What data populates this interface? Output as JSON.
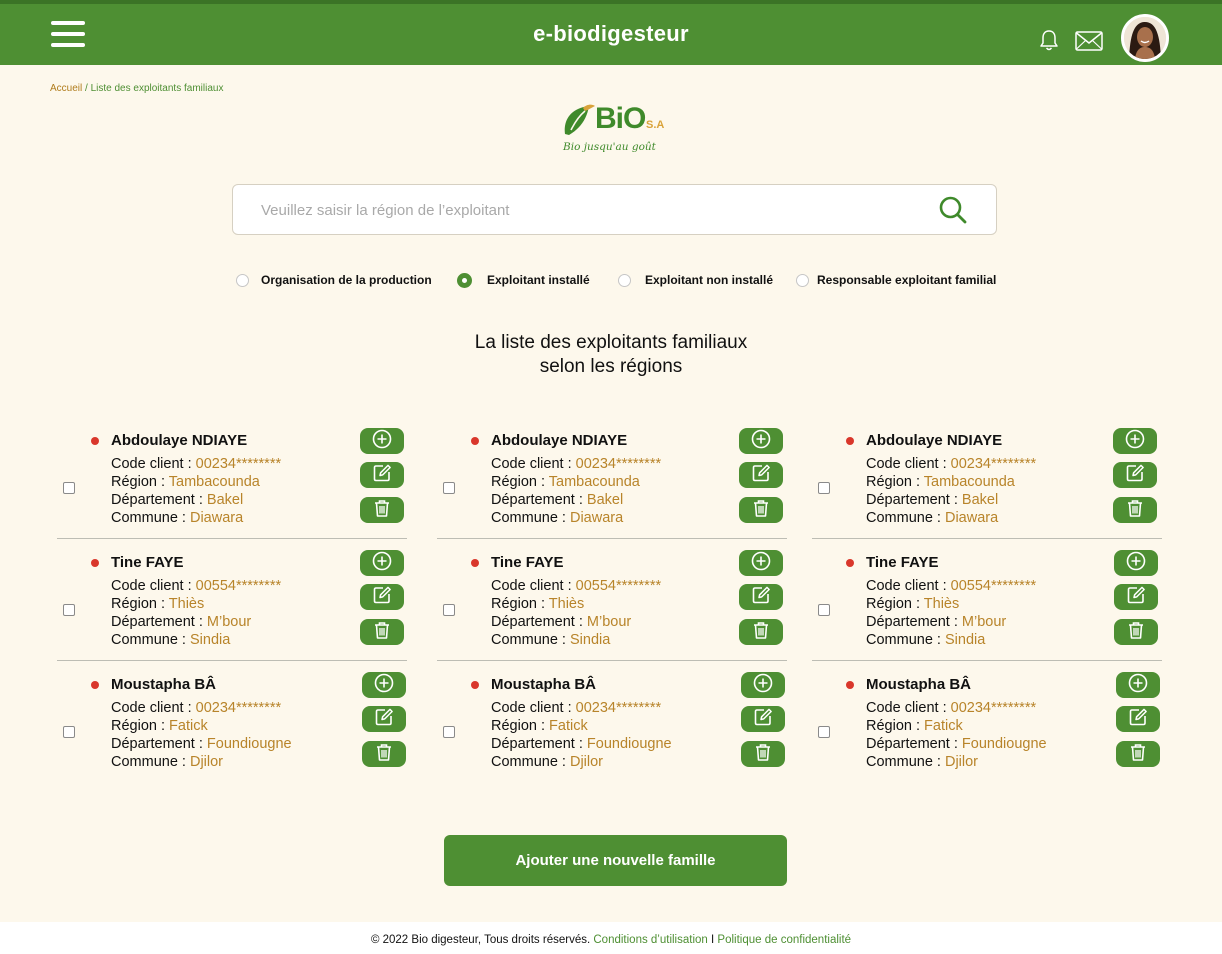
{
  "header": {
    "brand": "e-biodigesteur",
    "menu_icon": "hamburger-menu-icon",
    "bell_icon": "bell-icon",
    "mail_icon": "envelope-icon",
    "accent_color": "#4e8f33"
  },
  "breadcrumb": {
    "home": "Accueil",
    "separator": " / ",
    "current": "Liste des exploitants familiaux"
  },
  "logo": {
    "word": "BiO",
    "suffix": "S.A",
    "tagline": "Bio jusqu'au goût"
  },
  "search": {
    "placeholder": "Veuillez saisir la région de l’exploitant",
    "value": ""
  },
  "filters": [
    {
      "label": "Organisation de la production",
      "selected": false
    },
    {
      "label": "Exploitant installé",
      "selected": true
    },
    {
      "label": "Exploitant non installé",
      "selected": false
    },
    {
      "label": "Responsable exploitant familial",
      "selected": false
    }
  ],
  "heading": {
    "line1": "La liste des exploitants familiaux",
    "line2": "selon les régions"
  },
  "labels": {
    "code": "Code client : ",
    "region": "Région : ",
    "departement": "Département : ",
    "commune": "Commune : "
  },
  "exploitants": [
    {
      "name": "Abdoulaye NDIAYE",
      "code": "00234********",
      "region": "Tambacounda",
      "departement": "Bakel",
      "commune": "Diawara"
    },
    {
      "name": "Tine FAYE",
      "code": "00554********",
      "region": "Thiès",
      "departement": "M’bour",
      "commune": "Sindia"
    },
    {
      "name": "Moustapha BÂ",
      "code": "00234********",
      "region": "Fatick",
      "departement": "Foundiougne",
      "commune": "Djilor"
    }
  ],
  "add_button": "Ajouter une nouvelle famille",
  "footer": {
    "copyright": "© 2022 Bio digesteur, Tous droits réservés.",
    "terms": "Conditions d’utilisation",
    "divider": "I",
    "privacy": "Politique de confidentialité"
  }
}
